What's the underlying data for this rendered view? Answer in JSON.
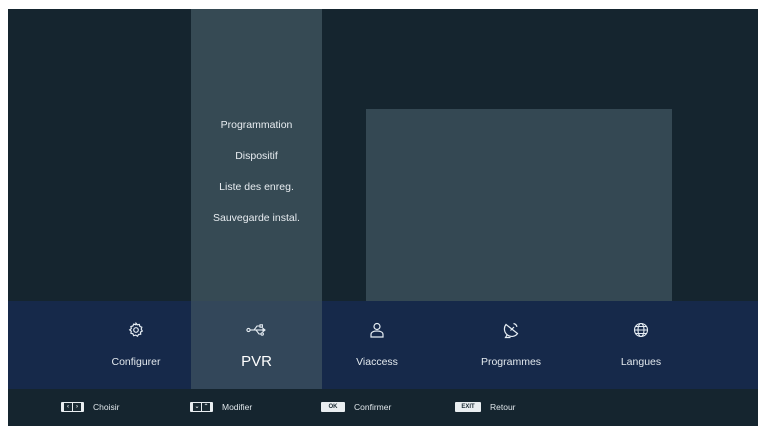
{
  "submenu": {
    "items": [
      {
        "label": "Programmation"
      },
      {
        "label": "Dispositif"
      },
      {
        "label": "Liste des enreg."
      },
      {
        "label": "Sauvegarde instal."
      }
    ]
  },
  "main_menu": {
    "selected": "PVR",
    "items": [
      {
        "label": "Configurer",
        "icon": "gear-icon"
      },
      {
        "label": "PVR",
        "icon": "usb-icon"
      },
      {
        "label": "Viaccess",
        "icon": "user-icon"
      },
      {
        "label": "Programmes",
        "icon": "satellite-dish-icon"
      },
      {
        "label": "Langues",
        "icon": "globe-icon"
      }
    ]
  },
  "hints": [
    {
      "key": "‹ ›",
      "label": "Choisir"
    },
    {
      "key": "⌄ ⌃",
      "label": "Modifier"
    },
    {
      "key": "OK",
      "label": "Confirmer"
    },
    {
      "key": "EXIT",
      "label": "Retour"
    }
  ],
  "colors": {
    "background": "#15252f",
    "submenu_column": "#364a54",
    "preview_box": "#344853",
    "menu_bar": "#16294a",
    "menu_active": "#33475a"
  }
}
